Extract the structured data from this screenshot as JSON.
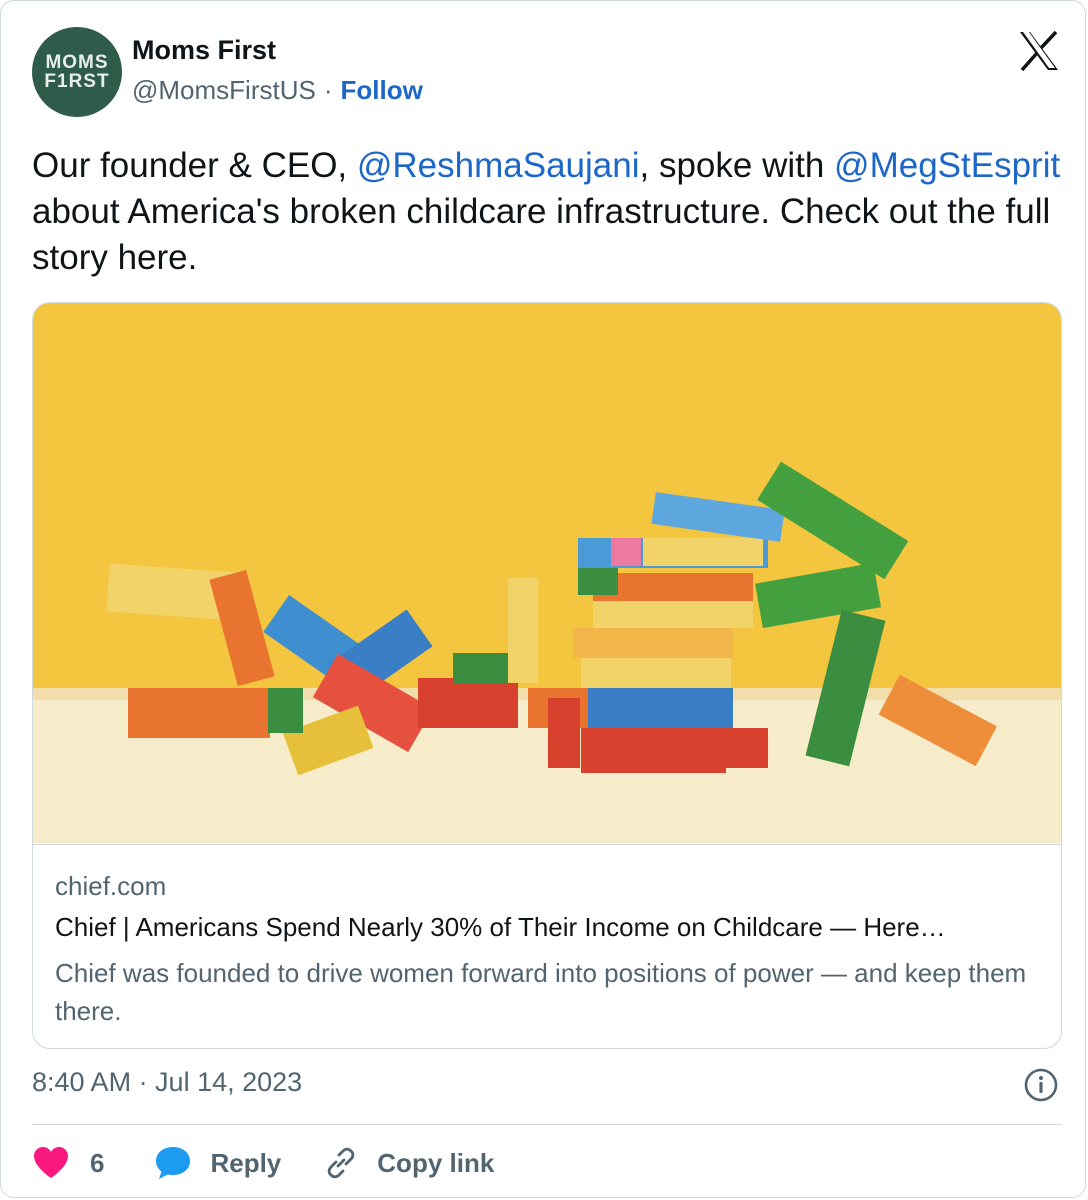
{
  "author": {
    "display_name": "Moms First",
    "handle": "@MomsFirstUS",
    "separator": "·",
    "follow_label": "Follow",
    "avatar_text": [
      "MOMS",
      "F1RST"
    ]
  },
  "tweet": {
    "text_parts": [
      {
        "text": "Our founder & CEO, ",
        "mention": false
      },
      {
        "text": "@ReshmaSaujani",
        "mention": true
      },
      {
        "text": ", spoke with ",
        "mention": false
      },
      {
        "text": "@MegStEsprit",
        "mention": true
      },
      {
        "text": " about America's broken childcare infrastructure. Check out the full story here.",
        "mention": false
      }
    ]
  },
  "link_card": {
    "domain": "chief.com",
    "title": "Chief | Americans Spend Nearly 30% of Their Income on Childcare — Here…",
    "description": "Chief was founded to drive women forward into positions of power — and keep them there."
  },
  "timestamp": "8:40 AM · Jul 14, 2023",
  "actions": {
    "like_count": "6",
    "reply_label": "Reply",
    "copy_link_label": "Copy link"
  },
  "icons": {
    "platform_logo": "x-logo-icon",
    "info": "info-icon",
    "like": "heart-icon",
    "reply": "speech-bubble-icon",
    "copy_link": "link-icon"
  },
  "colors": {
    "link_blue": "#1d67c9",
    "text_primary": "#0f1419",
    "text_secondary": "#536471",
    "heart_pink": "#f91880",
    "reply_blue": "#1d9bf0",
    "avatar_green": "#2f5b4a"
  }
}
